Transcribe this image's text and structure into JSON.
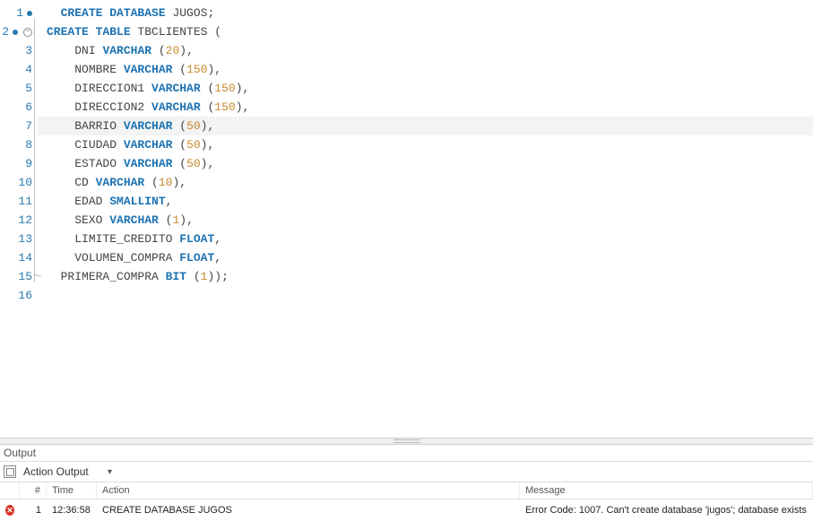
{
  "editor": {
    "lines": [
      {
        "n": "1",
        "dot": true,
        "collapse": false,
        "fold": null,
        "tokens": [
          [
            "kw",
            "CREATE "
          ],
          [
            "kw",
            "DATABASE "
          ],
          [
            "tok",
            "JUGOS"
          ],
          [
            "pn",
            ";"
          ]
        ]
      },
      {
        "n": "2",
        "dot": true,
        "collapse": true,
        "fold": null,
        "tokens": [
          [
            "kw",
            "CREATE "
          ],
          [
            "kw",
            "TABLE "
          ],
          [
            "tok",
            "TBCLIENTES "
          ],
          [
            "pn",
            "("
          ]
        ]
      },
      {
        "n": "3",
        "dot": false,
        "collapse": false,
        "fold": "mid",
        "tokens": [
          [
            "tok",
            "DNI "
          ],
          [
            "kw",
            "VARCHAR "
          ],
          [
            "pn",
            "("
          ],
          [
            "num",
            "20"
          ],
          [
            "pn",
            ")"
          ],
          [
            "pn",
            ","
          ]
        ]
      },
      {
        "n": "4",
        "dot": false,
        "collapse": false,
        "fold": "mid",
        "tokens": [
          [
            "tok",
            "NOMBRE "
          ],
          [
            "kw",
            "VARCHAR "
          ],
          [
            "pn",
            "("
          ],
          [
            "num",
            "150"
          ],
          [
            "pn",
            ")"
          ],
          [
            "pn",
            ","
          ]
        ]
      },
      {
        "n": "5",
        "dot": false,
        "collapse": false,
        "fold": "mid",
        "tokens": [
          [
            "tok",
            "DIRECCION1 "
          ],
          [
            "kw",
            "VARCHAR "
          ],
          [
            "pn",
            "("
          ],
          [
            "num",
            "150"
          ],
          [
            "pn",
            ")"
          ],
          [
            "pn",
            ","
          ]
        ]
      },
      {
        "n": "6",
        "dot": false,
        "collapse": false,
        "fold": "mid",
        "tokens": [
          [
            "tok",
            "DIRECCION2 "
          ],
          [
            "kw",
            "VARCHAR "
          ],
          [
            "pn",
            "("
          ],
          [
            "num",
            "150"
          ],
          [
            "pn",
            ")"
          ],
          [
            "pn",
            ","
          ]
        ]
      },
      {
        "n": "7",
        "dot": false,
        "collapse": false,
        "fold": "mid",
        "hl": true,
        "tokens": [
          [
            "tok",
            "BARRIO "
          ],
          [
            "kw",
            "VARCHAR "
          ],
          [
            "pn",
            "("
          ],
          [
            "num",
            "50"
          ],
          [
            "pn",
            ")"
          ],
          [
            "pn",
            ","
          ]
        ]
      },
      {
        "n": "8",
        "dot": false,
        "collapse": false,
        "fold": "mid",
        "tokens": [
          [
            "tok",
            "CIUDAD "
          ],
          [
            "kw",
            "VARCHAR "
          ],
          [
            "pn",
            "("
          ],
          [
            "num",
            "50"
          ],
          [
            "pn",
            ")"
          ],
          [
            "pn",
            ","
          ]
        ]
      },
      {
        "n": "9",
        "dot": false,
        "collapse": false,
        "fold": "mid",
        "tokens": [
          [
            "tok",
            "ESTADO "
          ],
          [
            "kw",
            "VARCHAR "
          ],
          [
            "pn",
            "("
          ],
          [
            "num",
            "50"
          ],
          [
            "pn",
            ")"
          ],
          [
            "pn",
            ","
          ]
        ]
      },
      {
        "n": "10",
        "dot": false,
        "collapse": false,
        "fold": "mid",
        "tokens": [
          [
            "tok",
            "CD "
          ],
          [
            "kw",
            "VARCHAR "
          ],
          [
            "pn",
            "("
          ],
          [
            "num",
            "10"
          ],
          [
            "pn",
            ")"
          ],
          [
            "pn",
            ","
          ]
        ]
      },
      {
        "n": "11",
        "dot": false,
        "collapse": false,
        "fold": "mid",
        "tokens": [
          [
            "tok",
            "EDAD "
          ],
          [
            "kw",
            "SMALLINT"
          ],
          [
            "pn",
            ","
          ]
        ]
      },
      {
        "n": "12",
        "dot": false,
        "collapse": false,
        "fold": "mid",
        "tokens": [
          [
            "tok",
            "SEXO "
          ],
          [
            "kw",
            "VARCHAR "
          ],
          [
            "pn",
            "("
          ],
          [
            "num",
            "1"
          ],
          [
            "pn",
            ")"
          ],
          [
            "pn",
            ","
          ]
        ]
      },
      {
        "n": "13",
        "dot": false,
        "collapse": false,
        "fold": "mid",
        "tokens": [
          [
            "tok",
            "LIMITE_CREDITO "
          ],
          [
            "kw",
            "FLOAT"
          ],
          [
            "pn",
            ","
          ]
        ]
      },
      {
        "n": "14",
        "dot": false,
        "collapse": false,
        "fold": "mid",
        "tokens": [
          [
            "tok",
            "VOLUMEN_COMPRA "
          ],
          [
            "kw",
            "FLOAT"
          ],
          [
            "pn",
            ","
          ]
        ]
      },
      {
        "n": "15",
        "dot": false,
        "collapse": false,
        "fold": "end",
        "tokens": [
          [
            "tok",
            "PRIMERA_COMPRA "
          ],
          [
            "kw",
            "BIT "
          ],
          [
            "pn",
            "("
          ],
          [
            "num",
            "1"
          ],
          [
            "pn",
            ")"
          ],
          [
            "pn",
            ")"
          ],
          [
            "pn",
            ";"
          ]
        ]
      },
      {
        "n": "16",
        "dot": false,
        "collapse": false,
        "fold": null,
        "tokens": []
      }
    ]
  },
  "output": {
    "section_label": "Output",
    "selector": "Action Output",
    "headers": {
      "num": "#",
      "time": "Time",
      "action": "Action",
      "message": "Message"
    },
    "rows": [
      {
        "status": "error",
        "num": "1",
        "time": "12:36:58",
        "action": "CREATE DATABASE JUGOS",
        "message": "Error Code: 1007. Can't create database 'jugos'; database exists"
      }
    ]
  }
}
